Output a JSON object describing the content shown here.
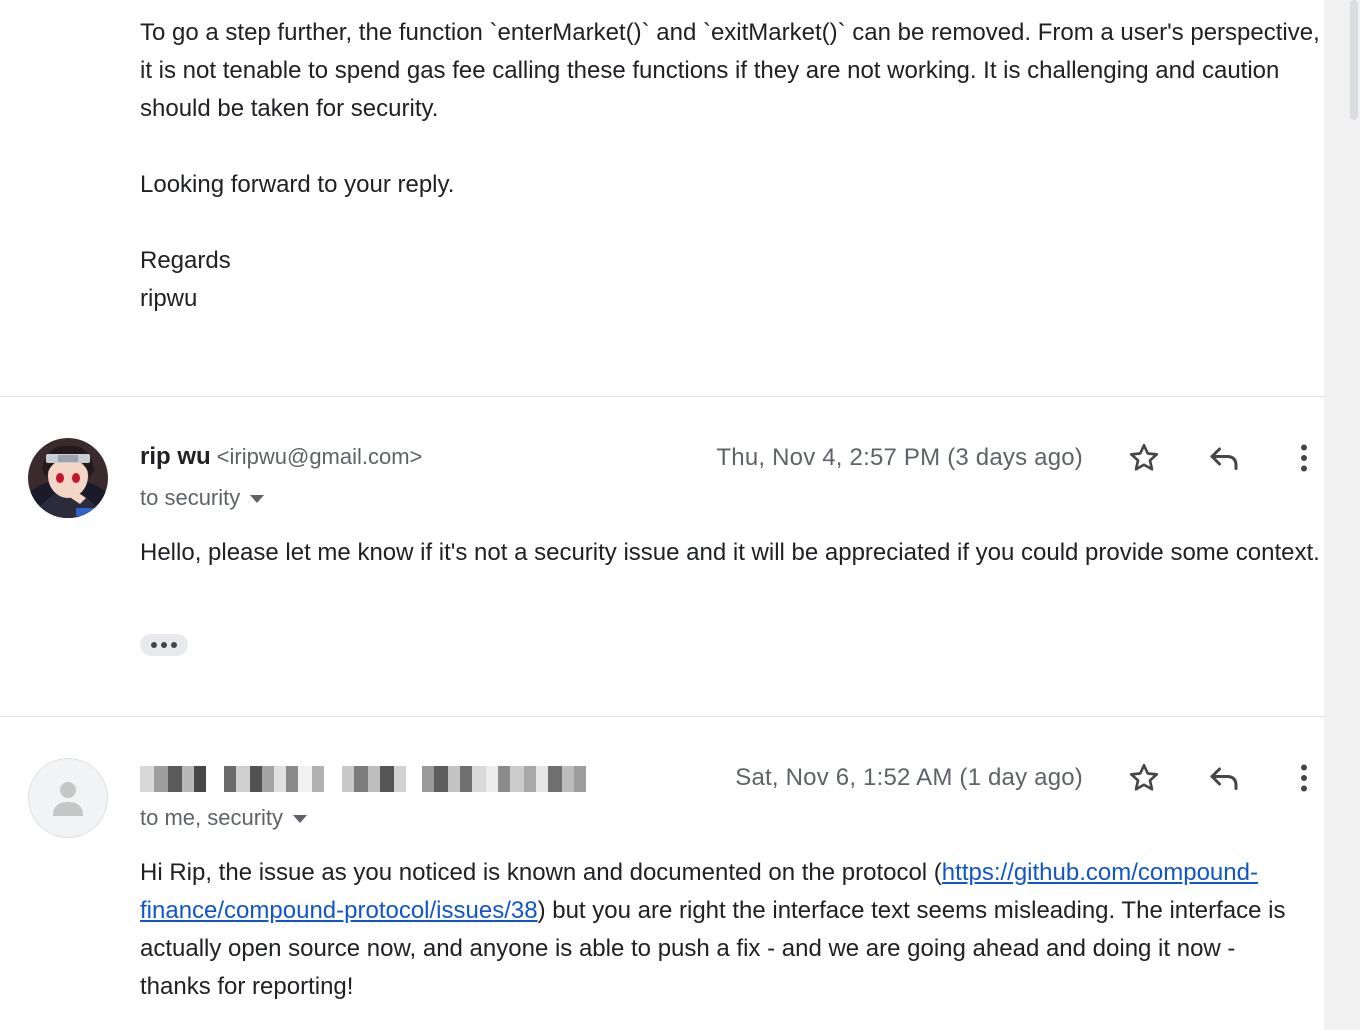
{
  "previous_message": {
    "paragraphs": [
      "To go a step further, the function `enterMarket()` and `exitMarket()` can be removed. From a user's perspective, it is not tenable to spend gas fee calling these functions if they are not working. It is challenging and caution should be taken for security.",
      "Looking forward to your reply."
    ],
    "signoff": "Regards",
    "signature": "ripwu"
  },
  "message_1": {
    "sender_name": "rip wu",
    "sender_email": "<iripwu@gmail.com>",
    "recipients": "to security",
    "date": "Thu, Nov 4, 2:57 PM (3 days ago)",
    "body": "Hello, please let me know if it's not a security issue and it will be appreciated if you could provide some context.",
    "avatar_icon": "user-avatar-anime"
  },
  "message_2": {
    "sender_name_redacted": true,
    "recipients": "to me, security",
    "date": "Sat, Nov 6, 1:52 AM (1 day ago)",
    "body_before_link": "Hi Rip, the issue as you noticed is known and documented on the protocol (",
    "link_text": "https://github.com/compound-finance/compound-protocol/issues/38",
    "body_after_link": ") but you are right the interface text seems misleading. The interface is actually open source now, and anyone is able to push a fix - and we are going ahead and doing it now - thanks for reporting!",
    "avatar_icon": "default-person-icon"
  },
  "icons": {
    "star": "star-icon",
    "reply": "reply-icon",
    "more": "more-vert-icon"
  },
  "colors": {
    "text": "#202124",
    "muted": "#5f6368",
    "link": "#1155cc",
    "divider": "#e0e0e0"
  }
}
